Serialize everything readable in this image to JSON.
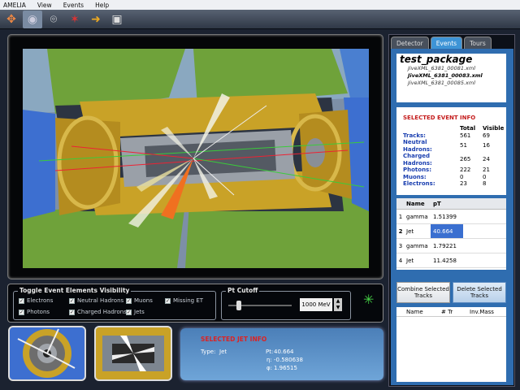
{
  "menu": {
    "items": [
      "AMELIA",
      "View",
      "Events",
      "Help"
    ]
  },
  "toolbar": {
    "buttons": [
      {
        "name": "axes-tool-icon",
        "glyph": "✥",
        "color": "#e84"
      },
      {
        "name": "globe-view-icon",
        "glyph": "◉",
        "color": "#ccd"
      },
      {
        "name": "camera-icon",
        "glyph": "⌾",
        "color": "#eee"
      },
      {
        "name": "detector-star-icon",
        "glyph": "✶",
        "color": "#d33"
      },
      {
        "name": "arrow-forward-icon",
        "glyph": "➜",
        "color": "#ea2"
      },
      {
        "name": "monitor-icon",
        "glyph": "▣",
        "color": "#ddd"
      }
    ]
  },
  "visibility": {
    "title": "Toggle Event Elements Visibility",
    "items": [
      {
        "label": "Electrons",
        "checked": true
      },
      {
        "label": "Neutral Hadrons",
        "checked": true
      },
      {
        "label": "Muons",
        "checked": true
      },
      {
        "label": "Missing ET",
        "checked": true
      },
      {
        "label": "Photons",
        "checked": true
      },
      {
        "label": "Charged Hadrons",
        "checked": true
      },
      {
        "label": "Jets",
        "checked": true
      }
    ]
  },
  "pt_cutoff": {
    "title": "Pt Cutoff",
    "value": "1000 MeV"
  },
  "jet_info": {
    "title": "SELECTED JET INFO",
    "type_label": "Type:",
    "type_value": "Jet",
    "pt_label": "Pt:",
    "pt_value": "40.664",
    "eta_label": "η:",
    "eta_value": "-0.580638",
    "phi_label": "φ:",
    "phi_value": "1.96515"
  },
  "sidebar": {
    "tabs": [
      {
        "label": "Detector",
        "active": false
      },
      {
        "label": "Events",
        "active": true
      },
      {
        "label": "Tours",
        "active": false
      }
    ],
    "package": {
      "title": "test_package",
      "files": [
        "JiveXML_6381_00081.xml",
        "JiveXML_6381_00083.xml",
        "JiveXML_6381_00085.xml"
      ],
      "selected": 1
    },
    "event_info": {
      "title": "SELECTED EVENT INFO",
      "col_total": "Total",
      "col_visible": "Visible",
      "rows": [
        {
          "label": "Tracks:",
          "total": "561",
          "visible": "69"
        },
        {
          "label": "Neutral Hadrons:",
          "total": "51",
          "visible": "16"
        },
        {
          "label": "Charged Hadrons:",
          "total": "265",
          "visible": "24"
        },
        {
          "label": "Photons:",
          "total": "222",
          "visible": "21"
        },
        {
          "label": "Muons:",
          "total": "0",
          "visible": "0"
        },
        {
          "label": "Electrons:",
          "total": "23",
          "visible": "8"
        }
      ]
    },
    "jets_table": {
      "col_name": "Name",
      "col_pt": "pT",
      "rows": [
        {
          "idx": "1",
          "name": "gamma",
          "pt": "1.51399"
        },
        {
          "idx": "2",
          "name": "Jet",
          "pt": "40.664",
          "selected": true
        },
        {
          "idx": "3",
          "name": "gamma",
          "pt": "1.79221"
        },
        {
          "idx": "4",
          "name": "Jet",
          "pt": "11.4258"
        }
      ]
    },
    "combine_button": "Combine Selected Tracks",
    "delete_button": "Delete Selected Tracks",
    "combo_table": {
      "col_name": "Name",
      "col_tr": "# Tr",
      "col_mass": "Inv.Mass"
    }
  }
}
